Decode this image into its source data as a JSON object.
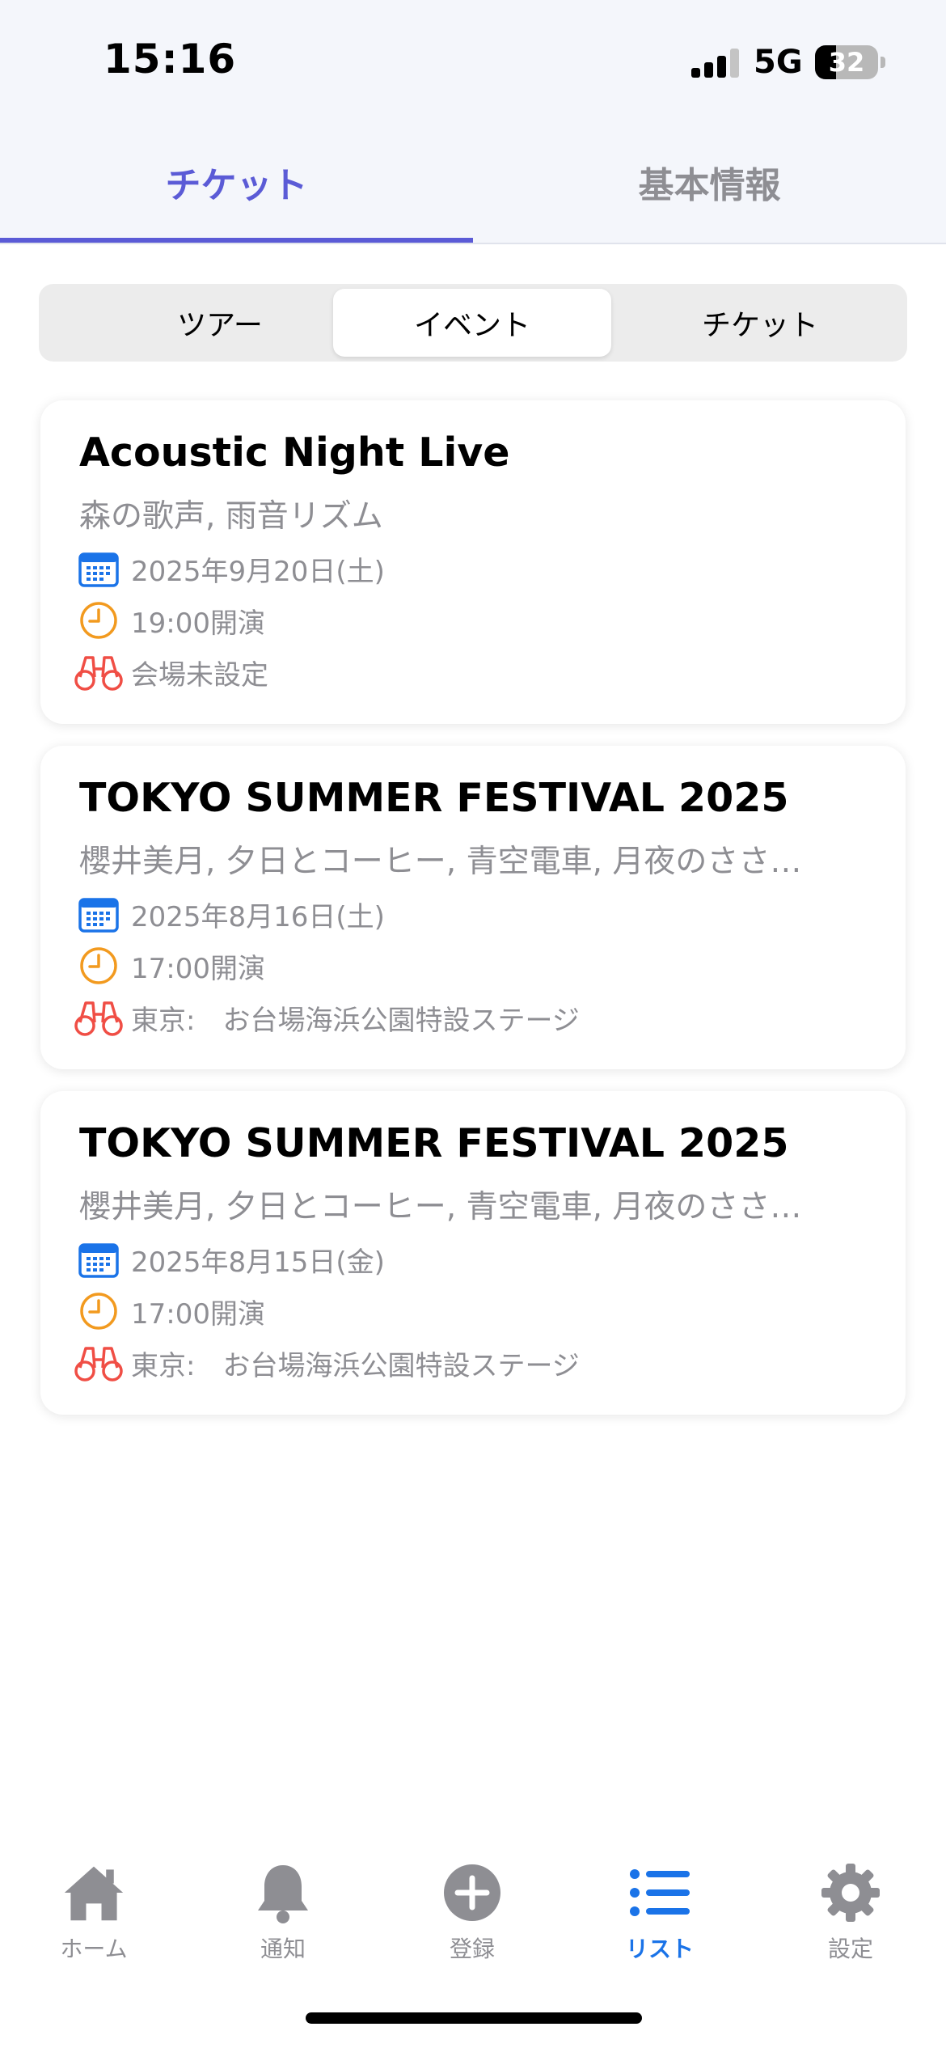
{
  "status_bar": {
    "time": "15:16",
    "network": "5G",
    "battery": "32"
  },
  "top_tabs": [
    {
      "label": "チケット",
      "active": true
    },
    {
      "label": "基本情報",
      "active": false
    }
  ],
  "segmented": [
    {
      "label": "ツアー",
      "selected": false
    },
    {
      "label": "イベント",
      "selected": true
    },
    {
      "label": "チケット",
      "selected": false
    }
  ],
  "events": [
    {
      "title": "Acoustic Night Live",
      "artists": "森の歌声, 雨音リズム",
      "date": "2025年9月20日(土)",
      "time": "19:00開演",
      "venue": "会場未設定"
    },
    {
      "title": "TOKYO SUMMER FESTIVAL 2025",
      "artists": "櫻井美月, 夕日とコーヒー, 青空電車, 月夜のささ…",
      "date": "2025年8月16日(土)",
      "time": "17:00開演",
      "venue": "東京:　お台場海浜公園特設ステージ"
    },
    {
      "title": "TOKYO SUMMER FESTIVAL 2025",
      "artists": "櫻井美月, 夕日とコーヒー, 青空電車, 月夜のささ…",
      "date": "2025年8月15日(金)",
      "time": "17:00開演",
      "venue": "東京:　お台場海浜公園特設ステージ"
    }
  ],
  "tab_bar": [
    {
      "label": "ホーム",
      "icon": "house-icon",
      "active": false
    },
    {
      "label": "通知",
      "icon": "bell-icon",
      "active": false
    },
    {
      "label": "登録",
      "icon": "plus-circle-icon",
      "active": false
    },
    {
      "label": "リスト",
      "icon": "list-icon",
      "active": true
    },
    {
      "label": "設定",
      "icon": "gear-icon",
      "active": false
    }
  ],
  "colors": {
    "accent": "#5b5bd6",
    "tab_active": "#1a73e8",
    "calendar": "#1a73e8",
    "clock": "#f29a1f",
    "binoculars": "#f04e45",
    "secondary_text": "#8e8e93"
  }
}
